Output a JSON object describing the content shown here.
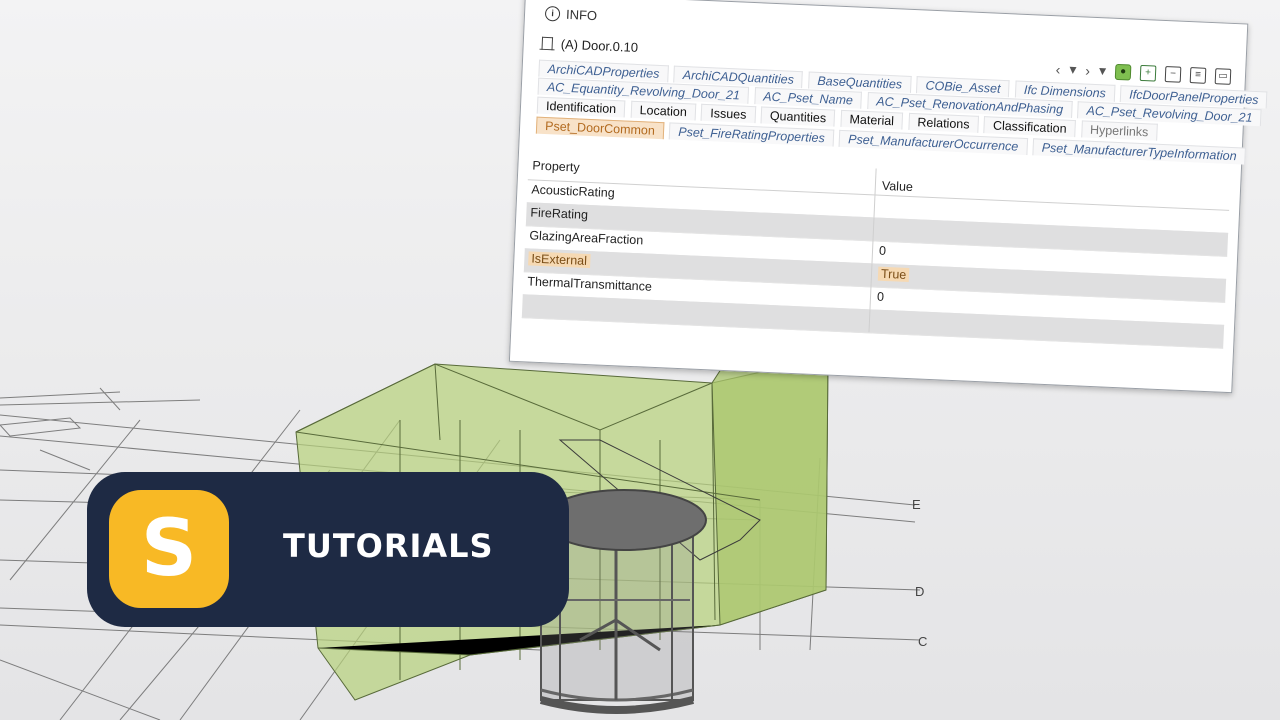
{
  "info_panel": {
    "title": "INFO",
    "object_name": "(A) Door.0.10",
    "nav": {
      "back": "‹",
      "menu1": "▾",
      "forward": "›",
      "menu2": "▾"
    },
    "tab_rows": [
      [
        "ArchiCADProperties",
        "ArchiCADQuantities",
        "BaseQuantities",
        "COBie_Asset",
        "Ifc Dimensions",
        "IfcDoorPanelProperties"
      ],
      [
        "AC_Equantity_Revolving_Door_21",
        "AC_Pset_Name",
        "AC_Pset_RenovationAndPhasing",
        "AC_Pset_Revolving_Door_21"
      ],
      [
        "Identification",
        "Location",
        "Issues",
        "Quantities",
        "Material",
        "Relations",
        "Classification",
        "Hyperlinks"
      ],
      [
        "Pset_DoorCommon",
        "Pset_FireRatingProperties",
        "Pset_ManufacturerOccurrence",
        "Pset_ManufacturerTypeInformation"
      ]
    ],
    "selected_tab": "Pset_DoorCommon",
    "columns": {
      "property": "Property",
      "value": "Value"
    },
    "rows": [
      {
        "property": "AcousticRating",
        "value": ""
      },
      {
        "property": "FireRating",
        "value": ""
      },
      {
        "property": "GlazingAreaFraction",
        "value": "0"
      },
      {
        "property": "IsExternal",
        "value": "True"
      },
      {
        "property": "ThermalTransmittance",
        "value": "0"
      }
    ]
  },
  "banner": {
    "logo_letter": "S",
    "label": "TUTORIALS",
    "colors": {
      "background": "#1e2a44",
      "logo": "#f8b925"
    }
  },
  "grid_labels": {
    "e": "E",
    "d": "D",
    "c": "C"
  }
}
